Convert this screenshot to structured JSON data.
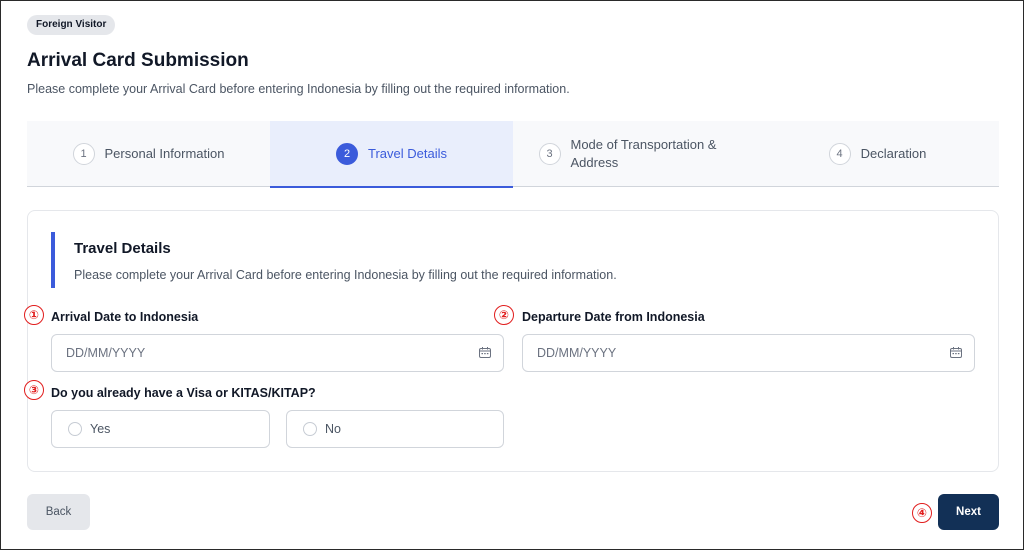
{
  "badge": "Foreign Visitor",
  "header": {
    "title": "Arrival Card Submission",
    "subtitle": "Please complete your Arrival Card before entering Indonesia by filling out the required information."
  },
  "steps": [
    {
      "num": "1",
      "label": "Personal Information"
    },
    {
      "num": "2",
      "label": "Travel Details"
    },
    {
      "num": "3",
      "label": "Mode of Transportation & Address"
    },
    {
      "num": "4",
      "label": "Declaration"
    }
  ],
  "section": {
    "title": "Travel Details",
    "subtitle": "Please complete your Arrival Card before entering Indonesia by filling out the required information."
  },
  "markers": [
    "①",
    "②",
    "③",
    "④"
  ],
  "fields": {
    "arrival": {
      "label": "Arrival Date to Indonesia",
      "value": "",
      "placeholder": "DD/MM/YYYY"
    },
    "departure": {
      "label": "Departure Date from Indonesia",
      "value": "",
      "placeholder": "DD/MM/YYYY"
    },
    "visa": {
      "label": "Do you already have a Visa or KITAS/KITAP?",
      "options": [
        "Yes",
        "No"
      ]
    }
  },
  "buttons": {
    "back": "Back",
    "next": "Next"
  },
  "colors": {
    "accent": "#3b5bdb",
    "primary_button": "#123056",
    "marker": "#e11d1d"
  },
  "icons": {
    "date_picker": "calendar-icon",
    "radio": "radio-unchecked"
  }
}
